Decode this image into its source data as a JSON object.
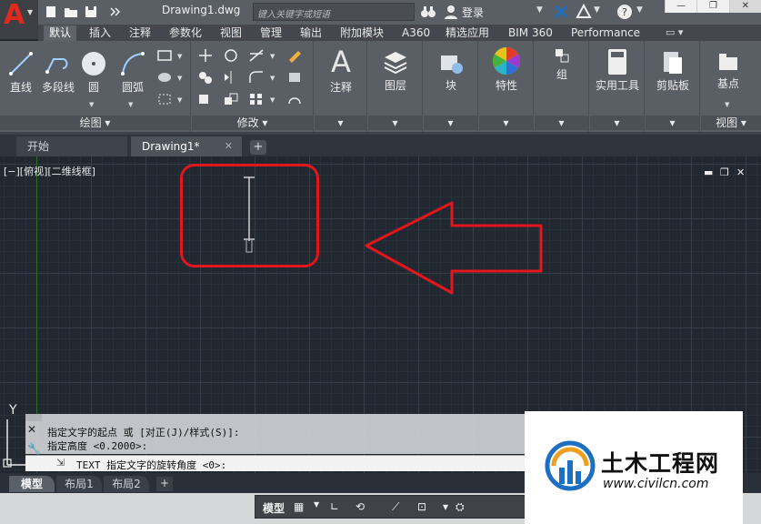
{
  "titlebar": {
    "app_logo": "A",
    "doc_title": "Drawing1.dwg",
    "search_placeholder": "键入关键字或短语",
    "login_label": "登录"
  },
  "ribbon_tabs": [
    "默认",
    "插入",
    "注释",
    "参数化",
    "视图",
    "管理",
    "输出",
    "附加模块",
    "A360",
    "精选应用",
    "BIM 360",
    "Performance"
  ],
  "ribbon": {
    "draw_tools": [
      "直线",
      "多段线",
      "圆",
      "圆弧"
    ],
    "draw_panel_title": "绘图",
    "modify_panel_title": "修改",
    "annotate_label": "注释",
    "layers_label": "图层",
    "block_label": "块",
    "properties_label": "特性",
    "group_label": "组",
    "utilities_label": "实用工具",
    "clipboard_label": "剪贴板",
    "basepoint_label": "基点",
    "view_panel_title": "视图"
  },
  "doc_tabs": {
    "start": "开始",
    "drawing": "Drawing1*"
  },
  "viewport": {
    "label": "[−][俯视][二维线框]"
  },
  "command": {
    "line1": "指定文字的起点 或 [对正(J)/样式(S)]:",
    "line2": "指定高度 <0.2000>:",
    "prompt": "TEXT 指定文字的旋转角度 <0>:"
  },
  "layout_tabs": [
    "模型",
    "布局1",
    "布局2"
  ],
  "status": {
    "model": "模型"
  },
  "watermark": {
    "title": "土木工程网",
    "url": "www.civilcn.com"
  },
  "colors": {
    "highlight": "#e2161c",
    "logo_red": "#e02a1f",
    "watermark_blue": "#1d6fc4"
  },
  "ucs": {
    "y_label": "Y"
  }
}
